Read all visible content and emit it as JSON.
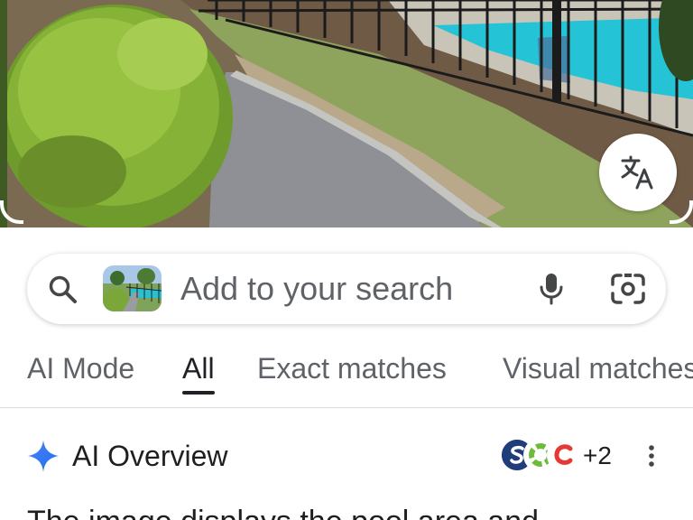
{
  "photo": {
    "alt": "",
    "translate_icon": "translate-icon"
  },
  "search": {
    "placeholder": "Add to your search",
    "value": "",
    "search_icon": "search-icon",
    "mic_icon": "mic-icon",
    "lens_icon": "camera-lens-icon"
  },
  "tabs": [
    {
      "label": "AI Mode",
      "active": false
    },
    {
      "label": "All",
      "active": true
    },
    {
      "label": "Exact matches",
      "active": false
    },
    {
      "label": "Visual matches",
      "active": false
    }
  ],
  "ai_overview": {
    "title": "AI Overview",
    "sources_extra": "+2",
    "body_start": "The image displays the pool area and"
  },
  "colors": {
    "accent": "#4285f4",
    "text_primary": "#1f1f1f",
    "text_secondary": "#5f6368",
    "pool": "#25c3d6"
  }
}
